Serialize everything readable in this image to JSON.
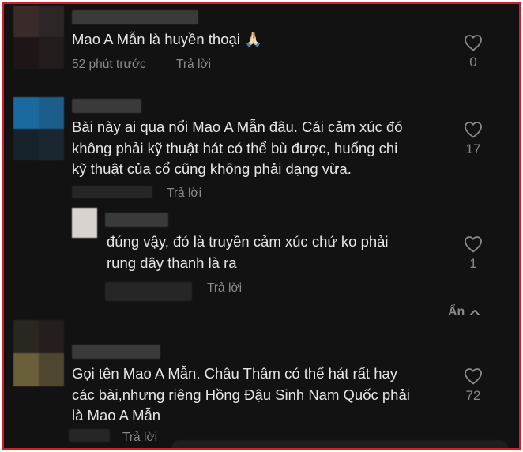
{
  "comments": [
    {
      "text": "Mao A Mẫn là huyền thoại 🙏🏻",
      "time": "52 phút trước",
      "reply_label": "Trả lời",
      "like_count": "0"
    },
    {
      "text": "Bài này ai qua nổi Mao A Mẫn đâu. Cái cảm xúc đó\nkhông phải kỹ thuật hát có thể bù được, huống chi\nkỹ thuật của cổ cũng không phải dạng vừa.",
      "reply_label": "Trả lời",
      "like_count": "17",
      "replies": [
        {
          "text": "đúng vậy, đó là truyền cảm xúc chứ ko phải\nrung dây thanh là ra",
          "reply_label": "Trả lời",
          "like_count": "1"
        }
      ],
      "hide_label": "Ẩn"
    },
    {
      "text": "Gọi tên Mao A Mẫn. Châu Thâm có thể hát rất hay\ncác bài,nhưng riêng Hồng Đậu Sinh Nam Quốc phải\nlà Mao A Mẫn",
      "reply_label": "Trả lời",
      "like_count": "72"
    }
  ],
  "colors": {
    "background": "#121212",
    "frame_border": "#d51e2a",
    "text": "#e6e6e6",
    "muted": "#8a8a8a"
  },
  "icons": {
    "like": "heart-outline-icon",
    "hide": "chevron-up-icon"
  }
}
